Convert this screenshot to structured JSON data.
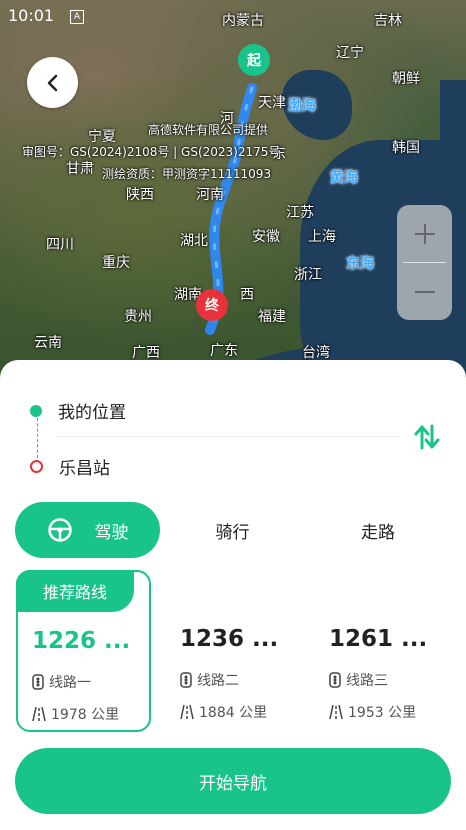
{
  "status_bar": {
    "time": "10:01",
    "indicator": "A"
  },
  "map": {
    "labels": {
      "neimenggu": "内蒙古",
      "jilin": "吉林",
      "liaoning": "辽宁",
      "chaoxian": "朝鲜",
      "tianjin": "天津",
      "bohai": "渤海",
      "ningxia": "宁夏",
      "hanguo": "韩国",
      "gansu": "甘肃",
      "huanghai": "黄海",
      "shaanxi": "陕西",
      "henan": "河南",
      "jiangsu": "江苏",
      "sichuan": "四川",
      "hubei": "湖北",
      "anhui": "安徽",
      "shanghai": "上海",
      "donghai": "东海",
      "chongqing": "重庆",
      "zhejiang": "浙江",
      "hunan": "湖南",
      "jiangxi": "西",
      "guizhou": "贵州",
      "fujian": "福建",
      "yunnan": "云南",
      "guangxi": "广西",
      "guangdong": "广东",
      "taiwan": "台湾",
      "he": "河",
      "dong": "东"
    },
    "copyright_1": "高德软件有限公司提供",
    "copyright_2": "审图号：GS(2024)2108号 | GS(2023)2175号",
    "copyright_3": "测绘资质：甲测资字11111093",
    "start_marker": "起",
    "end_marker": "终"
  },
  "locations": {
    "origin": "我的位置",
    "destination": "乐昌站"
  },
  "modes": [
    {
      "label": "驾驶"
    },
    {
      "label": "骑行"
    },
    {
      "label": "走路"
    }
  ],
  "routes": [
    {
      "tag": "推荐路线",
      "time": "1226 ...",
      "name": "线路一",
      "distance": "1978 公里"
    },
    {
      "time": "1236 ...",
      "name": "线路二",
      "distance": "1884 公里"
    },
    {
      "time": "1261 ...",
      "name": "线路三",
      "distance": "1953 公里"
    }
  ],
  "nav_button": "开始导航",
  "colors": {
    "accent": "#19c48b",
    "route_line": "#2b8cff",
    "end_marker": "#e8323b"
  }
}
